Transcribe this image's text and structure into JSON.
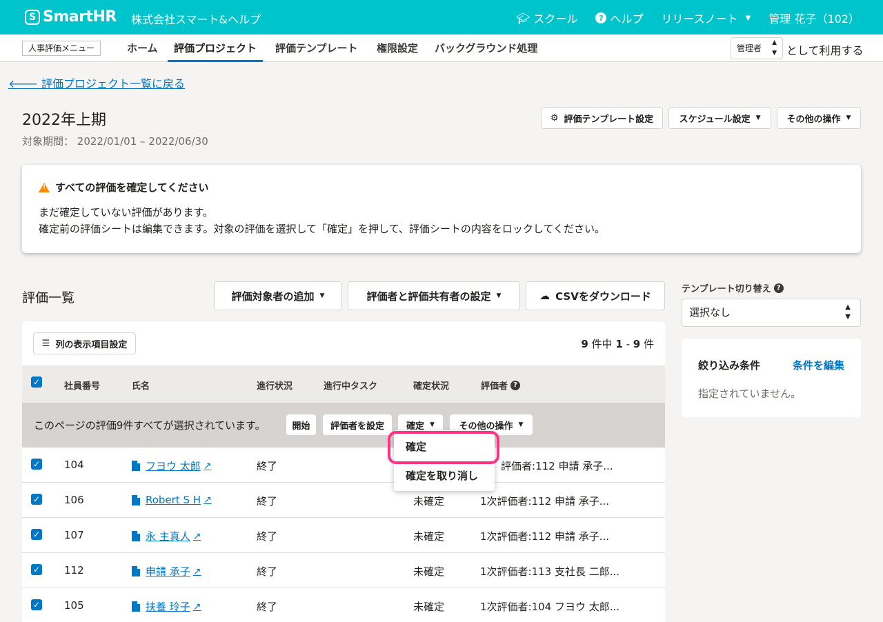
{
  "topbar": {
    "logo": "SmartHR",
    "logo_mark": "S",
    "company": "株式会社スマート&ヘルプ",
    "school": "スクール",
    "help": "ヘルプ",
    "release_notes": "リリースノート",
    "user": "管理 花子（102）"
  },
  "subnav": {
    "menu_tag": "人事評価メニュー",
    "tabs": [
      "ホーム",
      "評価プロジェクト",
      "評価テンプレート",
      "権限設定",
      "バックグラウンド処理"
    ],
    "active_tab": "評価プロジェクト",
    "role": "管理者",
    "role_suffix": "として利用する"
  },
  "page": {
    "back_link": "評価プロジェクト一覧に戻る",
    "title": "2022年上期",
    "period_label": "対象期間：",
    "period_value": "2022/01/01 – 2022/06/30",
    "template_settings": "評価テンプレート設定",
    "schedule_settings": "スケジュール設定",
    "other_actions": "その他の操作"
  },
  "alert": {
    "title": "すべての評価を確定してください",
    "line1": "まだ確定していない評価があります。",
    "line2": "確定前の評価シートは編集できます。対象の評価を選択して「確定」を押して、評価シートの内容をロックしてください。"
  },
  "list": {
    "title": "評価一覧",
    "add_targets": "評価対象者の追加",
    "set_evaluators": "評価者と評価共有者の設定",
    "csv_download": "CSVをダウンロード",
    "column_settings": "列の表示項目設定",
    "count_total": "9",
    "count_mid": "件中",
    "count_from": "1",
    "count_dash": "-",
    "count_to": "9",
    "count_suffix": "件",
    "headers": [
      "社員番号",
      "氏名",
      "進行状況",
      "進行中タスク",
      "確定状況",
      "評価者"
    ],
    "bulk_text": "このページの評価9件すべてが選択されています。",
    "bulk_start": "開始",
    "bulk_set_evaluator": "評価者を設定",
    "bulk_confirm": "確定",
    "bulk_other": "その他の操作",
    "dropdown": [
      "確定",
      "確定を取り消し"
    ],
    "rows": [
      {
        "id": "104",
        "name": "フヨウ 太郎",
        "status": "終了",
        "task": "",
        "confirm": "",
        "evaluator": "評価者:112 申請 承子..."
      },
      {
        "id": "106",
        "name": "Robert S H",
        "status": "終了",
        "task": "",
        "confirm": "未確定",
        "evaluator": "1次評価者:112 申請 承子..."
      },
      {
        "id": "107",
        "name": "永 主真人",
        "status": "終了",
        "task": "",
        "confirm": "未確定",
        "evaluator": "1次評価者:112 申請 承子..."
      },
      {
        "id": "112",
        "name": "申請 承子",
        "status": "終了",
        "task": "",
        "confirm": "未確定",
        "evaluator": "1次評価者:113 支社長 二郎..."
      },
      {
        "id": "105",
        "name": "扶養 玲子",
        "status": "終了",
        "task": "",
        "confirm": "未確定",
        "evaluator": "1次評価者:104 フヨウ 太郎..."
      }
    ]
  },
  "sidebar": {
    "template_switch_label": "テンプレート切り替え",
    "template_select_value": "選択なし",
    "filter_title": "絞り込み条件",
    "filter_edit": "条件を編集",
    "filter_empty": "指定されていません。"
  },
  "colors": {
    "brand": "#00c4cc",
    "link": "#0077c7",
    "highlight": "#ff3385",
    "warning": "#ff8800"
  }
}
